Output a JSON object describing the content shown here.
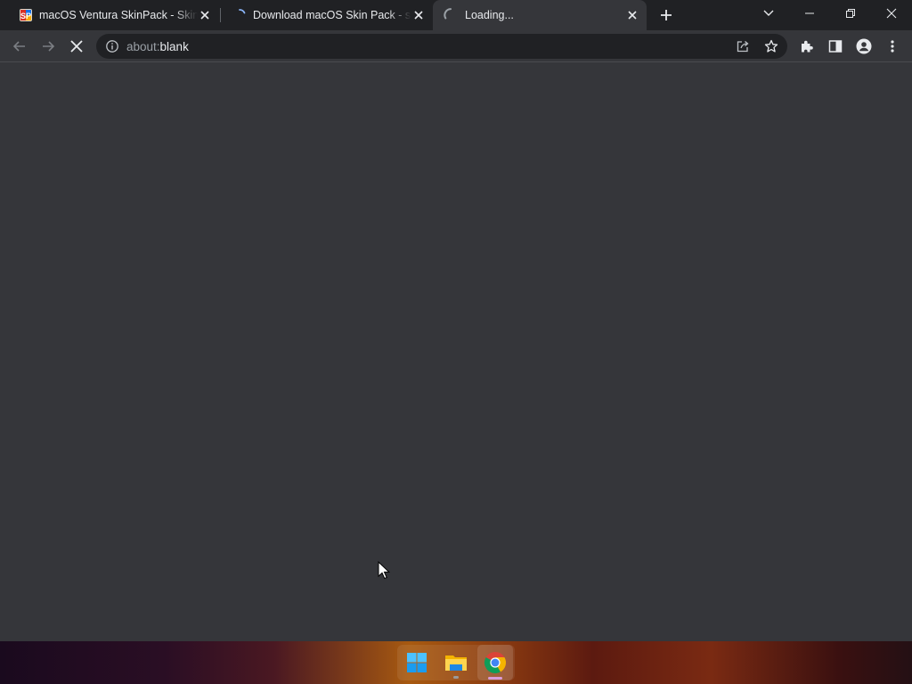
{
  "browser": {
    "tabs": [
      {
        "title": "macOS Ventura SkinPack - Skin P",
        "favicon": "skinpack-logo",
        "state": "loaded"
      },
      {
        "title": "Download macOS Skin Pack - skin",
        "favicon": "loading-spinner",
        "state": "loading"
      },
      {
        "title": "Loading...",
        "favicon": "loading-spinner",
        "state": "loading",
        "active": true
      }
    ],
    "address_bar": {
      "scheme": "about:",
      "host": "blank"
    }
  },
  "colors": {
    "titlebar": "#202124",
    "toolbar": "#35363a",
    "omnibox": "#202124",
    "text": "#e8eaed",
    "muted_text": "#9aa0a6"
  },
  "taskbar": {
    "apps": [
      "start-menu",
      "file-explorer",
      "google-chrome"
    ]
  }
}
